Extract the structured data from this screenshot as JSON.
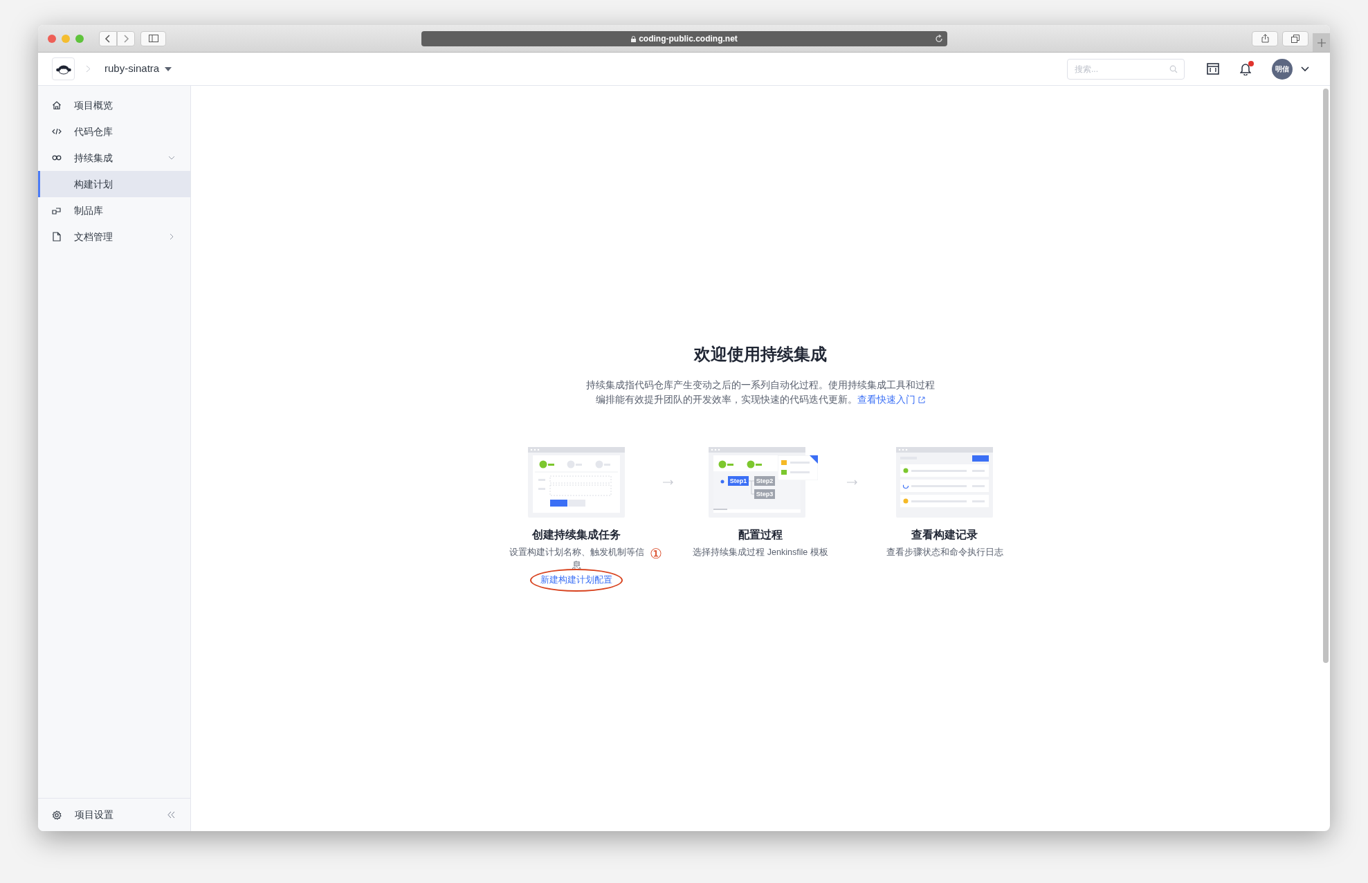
{
  "browser": {
    "url": "coding-public.coding.net"
  },
  "header": {
    "project": "ruby-sinatra",
    "search": {
      "placeholder": "搜索..."
    },
    "notification_dot": true,
    "avatar": "明信"
  },
  "sidebar": {
    "items": [
      {
        "label": "项目概览",
        "selected": false
      },
      {
        "label": "代码仓库",
        "selected": false
      },
      {
        "label": "持续集成",
        "selected": false,
        "expanded": true,
        "children": [
          {
            "label": "构建计划",
            "selected": true
          }
        ]
      },
      {
        "label": "制品库",
        "selected": false
      },
      {
        "label": "文档管理",
        "selected": false,
        "expanded": false
      }
    ],
    "footer": {
      "label": "项目设置"
    }
  },
  "main": {
    "title": "欢迎使用持续集成",
    "description": "持续集成指代码仓库产生变动之后的一系列自动化过程。使用持续集成工具和过程编排能有效提升团队的开发效率，实现快速的代码迭代更新。",
    "description_link": "查看快速入门",
    "steps": [
      {
        "kind": "create",
        "title": "创建持续集成任务",
        "description": "设置构建计划名称、触发机制等信息",
        "link": "新建构建计划配置"
      },
      {
        "kind": "configure",
        "title": "配置过程",
        "description": "选择持续集成过程 Jenkinsfile 模板",
        "step_labels": [
          "Step1",
          "Step2",
          "Step3"
        ]
      },
      {
        "kind": "records",
        "title": "查看构建记录",
        "description": "查看步骤状态和命令执行日志"
      }
    ],
    "annotation": {
      "number": "①"
    }
  }
}
